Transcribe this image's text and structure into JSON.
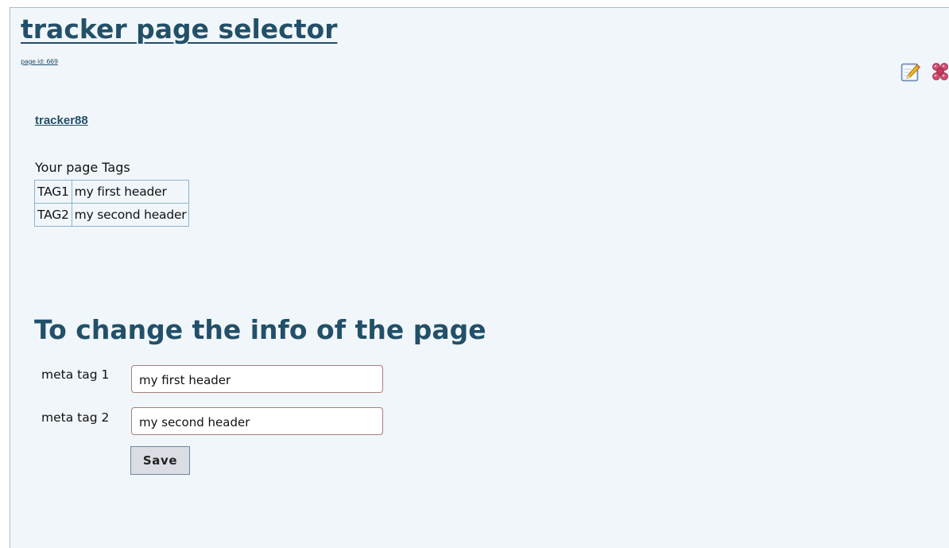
{
  "page": {
    "title": "tracker page selector",
    "page_id_label": "page id: 669"
  },
  "actions": {
    "edit_icon": "edit-pencil-icon",
    "remove_icon": "remove-x-icon"
  },
  "tracker": {
    "link_text": "tracker88"
  },
  "tags": {
    "caption": "Your page Tags",
    "rows": [
      {
        "tag": "TAG1",
        "value": "my first header"
      },
      {
        "tag": "TAG2",
        "value": "my second header"
      }
    ]
  },
  "form": {
    "heading": "To change the info of the page",
    "fields": [
      {
        "label": "meta tag 1",
        "value": "my first header"
      },
      {
        "label": "meta tag 2",
        "value": "my second header"
      }
    ],
    "save_label": "Save"
  },
  "colors": {
    "heading": "#225069",
    "background": "#f1f6fa",
    "table_border": "#8eb3cf",
    "input_border": "#a38277",
    "button_bg": "#dadde4"
  }
}
